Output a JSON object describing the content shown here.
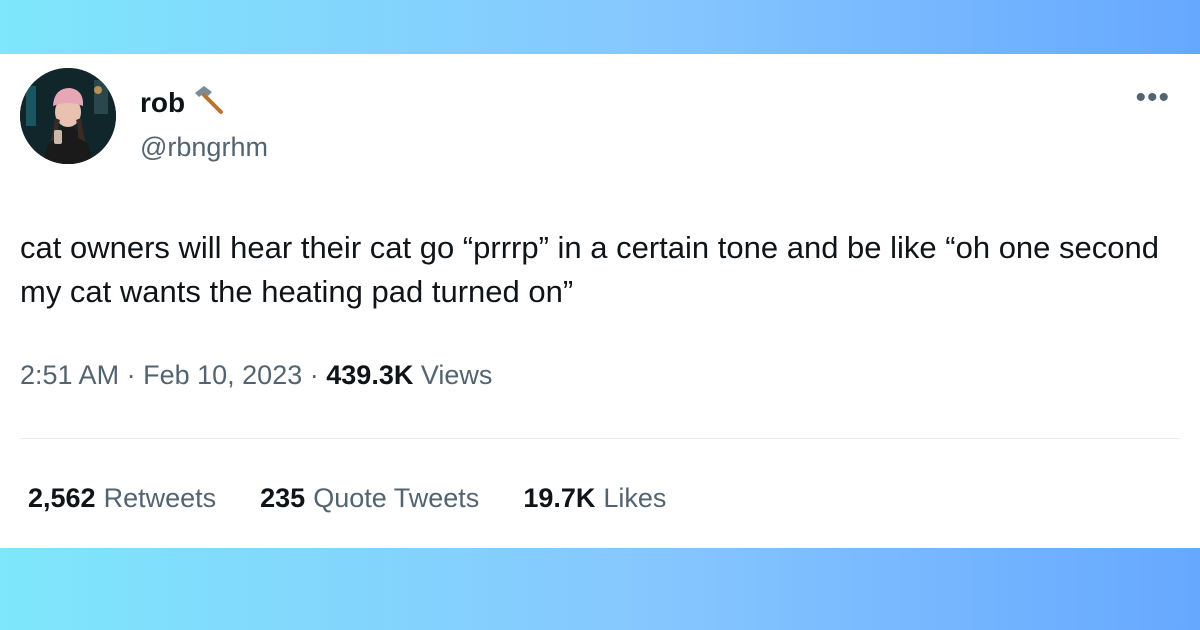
{
  "user": {
    "name": "rob",
    "name_icon": "hammer-icon",
    "handle": "@rbngrhm",
    "avatar_icon": "profile-photo"
  },
  "menu": {
    "more_label": "•••"
  },
  "tweet": {
    "text": "cat owners will hear their cat go “prrrp” in a certain tone and be like “oh one second my cat wants the heating pad turned on”",
    "time": "2:51 AM",
    "separator": "·",
    "date": "Feb 10, 2023",
    "views_count": "439.3K",
    "views_label": "Views"
  },
  "stats": {
    "retweets_count": "2,562",
    "retweets_label": "Retweets",
    "quotes_count": "235",
    "quotes_label": "Quote Tweets",
    "likes_count": "19.7K",
    "likes_label": "Likes"
  },
  "colors": {
    "text_primary": "#0f1419",
    "text_secondary": "#536471",
    "banner_gradient_start": "#7ee7fb",
    "banner_gradient_end": "#66a8ff"
  }
}
